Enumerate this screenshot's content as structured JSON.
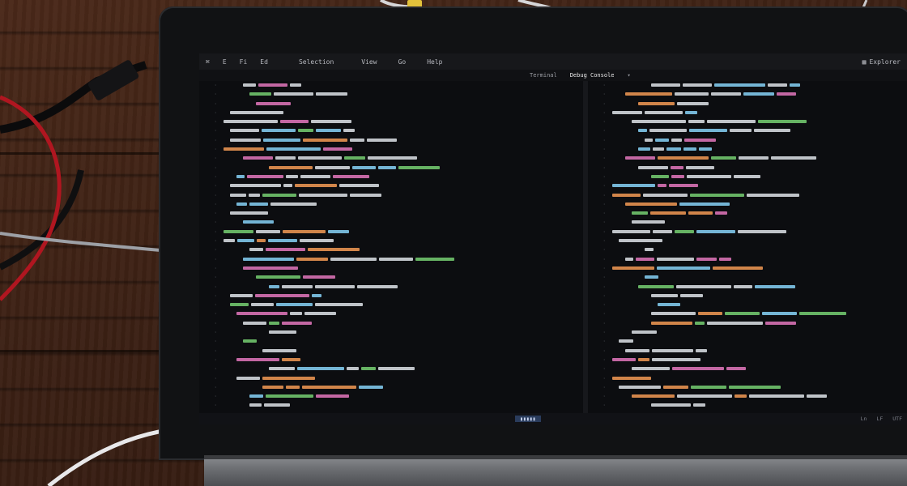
{
  "menubar": {
    "items": [
      {
        "label": "⌘"
      },
      {
        "label": "E"
      },
      {
        "label": "Fi"
      },
      {
        "label": "Ed"
      },
      {
        "label": "Selection"
      },
      {
        "label": "View"
      },
      {
        "label": "Go"
      },
      {
        "label": "Help"
      }
    ],
    "right_label": "Explorer"
  },
  "tabs": [
    {
      "label": "Terminal",
      "active": false
    },
    {
      "label": "Debug Console",
      "active": true
    }
  ],
  "status": {
    "left": "",
    "right_items": [
      "Ln",
      "LF",
      "UTF"
    ]
  },
  "colors": {
    "keyword": "#d46fb0",
    "string": "#e38f4f",
    "function": "#6fc06a",
    "variable": "#7ec3e6",
    "text": "#cfd2d8",
    "accent": "#3f7bd1"
  }
}
